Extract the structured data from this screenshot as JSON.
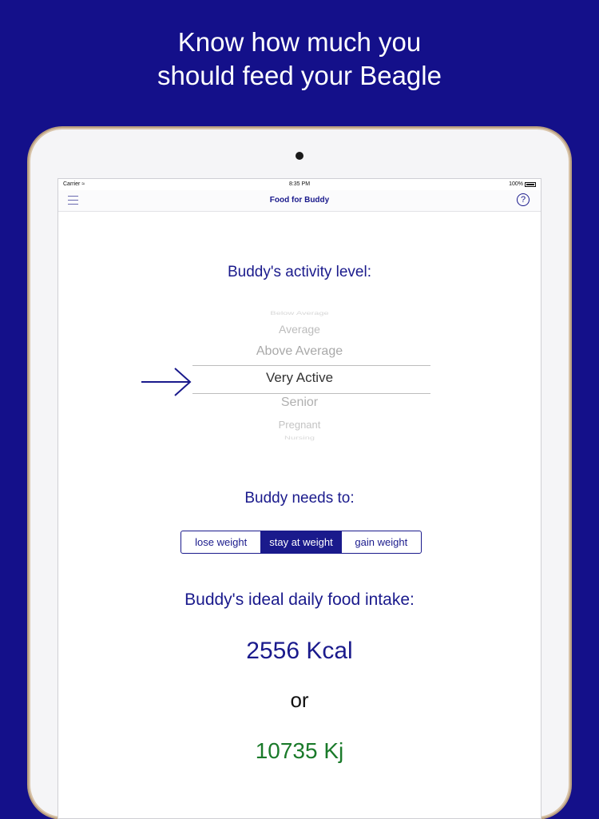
{
  "headline": {
    "line1": "Know how much you",
    "line2": "should feed your Beagle"
  },
  "status": {
    "carrier": "Carrier",
    "time": "8:35 PM",
    "battery": "100%"
  },
  "nav": {
    "title": "Food for Buddy",
    "help": "?"
  },
  "activity": {
    "title": "Buddy's activity level:",
    "options": [
      "Below Average",
      "Average",
      "Above Average",
      "Very Active",
      "Senior",
      "Pregnant",
      "Nursing"
    ],
    "selected": "Very Active"
  },
  "goal": {
    "title": "Buddy needs to:",
    "segments": [
      "lose weight",
      "stay at weight",
      "gain weight"
    ],
    "selected": "stay at weight"
  },
  "intake": {
    "title": "Buddy's ideal daily food intake:",
    "kcal": "2556 Kcal",
    "or": "or",
    "kj": "10735 Kj"
  },
  "colors": {
    "background": "#14108a",
    "accent": "#1a1a8c",
    "kj": "#1a7a2a"
  },
  "icons": {
    "menu": "hamburger-icon",
    "help": "question-circle-icon",
    "arrow": "right-arrow-icon"
  }
}
